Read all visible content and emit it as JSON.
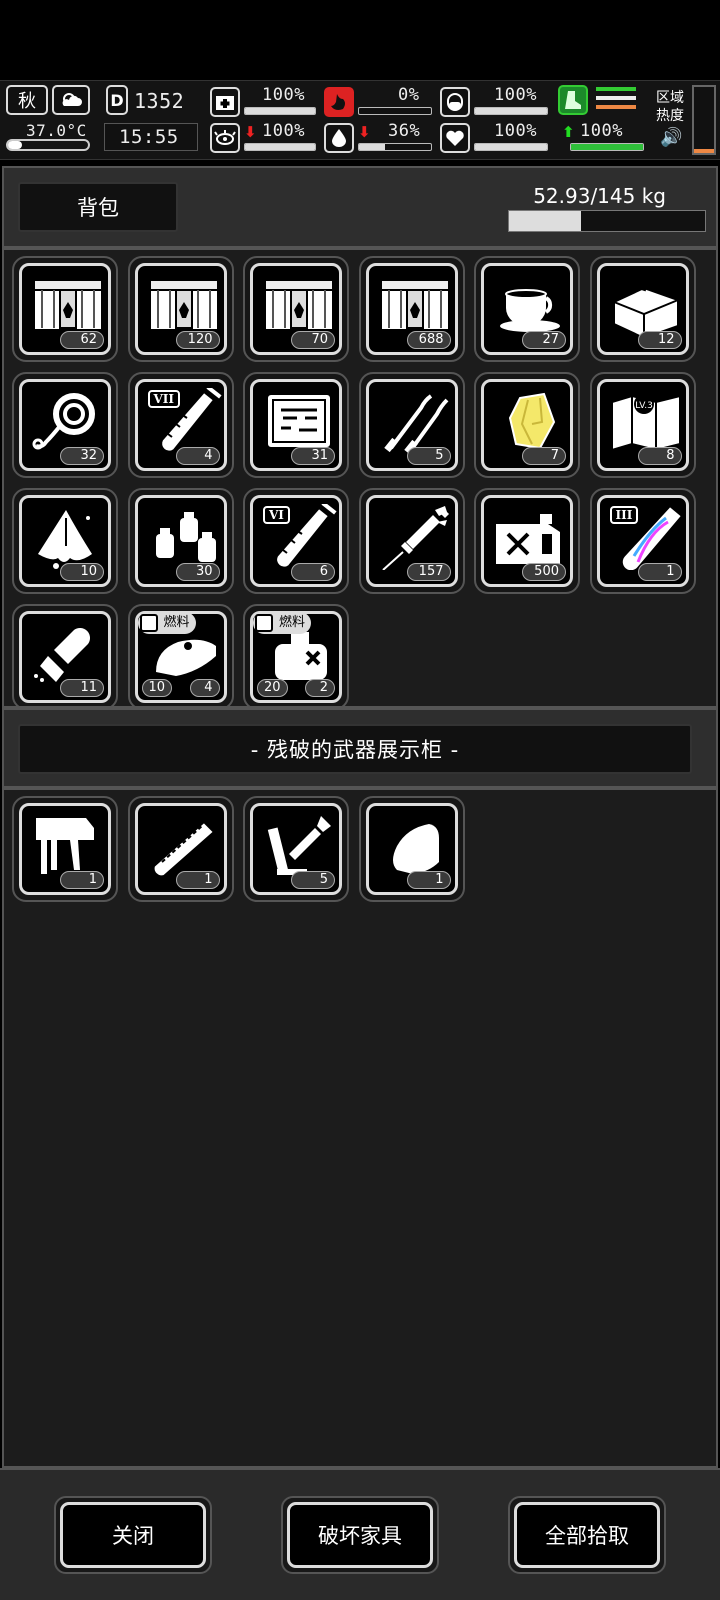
{
  "hud": {
    "season": "秋",
    "temperature": "37.0°C",
    "day": "1352",
    "time": "15:55",
    "stats": {
      "health": {
        "icon": "first-aid-icon",
        "value": "100%",
        "level": 1.0
      },
      "hunger": {
        "icon": "stomach-icon",
        "value": "0%",
        "level": 0.0
      },
      "fatigue": {
        "icon": "capsule-icon",
        "value": "100%",
        "level": 1.0
      },
      "immunity": {
        "icon": "virus-icon",
        "value": "100%",
        "level": 1.0
      },
      "thirst": {
        "icon": "water-drop-icon",
        "value": "36%",
        "level": 0.36
      },
      "mood": {
        "icon": "heart-icon",
        "value": "100%",
        "level": 1.0
      },
      "stamina": {
        "icon": "boot-icon",
        "value": "100%",
        "level": 1.0
      }
    },
    "zone_heat_label": "区域热度"
  },
  "backpack": {
    "title": "背包",
    "weight": "52.93/145 kg",
    "weight_fraction": 0.365
  },
  "backpack_items": [
    {
      "icon": "crate-icon",
      "count": "62"
    },
    {
      "icon": "crate-icon",
      "count": "120"
    },
    {
      "icon": "crate-icon",
      "count": "70"
    },
    {
      "icon": "crate-icon",
      "count": "688"
    },
    {
      "icon": "coffee-cup-icon",
      "count": "27"
    },
    {
      "icon": "toolbox-icon",
      "count": "12"
    },
    {
      "icon": "rope-icon",
      "count": "32"
    },
    {
      "icon": "test-tube-icon",
      "count": "4",
      "tier": "VII"
    },
    {
      "icon": "tool-kit-icon",
      "count": "31"
    },
    {
      "icon": "picks-icon",
      "count": "5"
    },
    {
      "icon": "crystal-icon",
      "count": "7"
    },
    {
      "icon": "map-icon",
      "count": "8",
      "map_level": "LV.3"
    },
    {
      "icon": "cloth-icon",
      "count": "10"
    },
    {
      "icon": "bottles-icon",
      "count": "30"
    },
    {
      "icon": "test-tube-icon",
      "count": "6",
      "tier": "VI"
    },
    {
      "icon": "syringe-icon",
      "count": "157"
    },
    {
      "icon": "fuel-can-icon",
      "count": "500"
    },
    {
      "icon": "dna-tube-icon",
      "count": "1",
      "tier": "III"
    },
    {
      "icon": "spray-bottle-icon",
      "count": "11"
    },
    {
      "icon": "fuel-tank-icon",
      "count": "4",
      "fuel_label": "燃料",
      "fuel_amount": "10"
    },
    {
      "icon": "generator-icon",
      "count": "2",
      "fuel_label": "燃料",
      "fuel_amount": "20"
    }
  ],
  "cabinet": {
    "title": "- 残破的武器展示柜 -"
  },
  "cabinet_items": [
    {
      "icon": "nail-gun-icon",
      "count": "1"
    },
    {
      "icon": "chainsaw-icon",
      "count": "1"
    },
    {
      "icon": "wrench-icon",
      "count": "5"
    },
    {
      "icon": "bullet-icon",
      "count": "1"
    }
  ],
  "footer": {
    "close": "关闭",
    "destroy": "破坏家具",
    "take_all": "全部拾取"
  }
}
